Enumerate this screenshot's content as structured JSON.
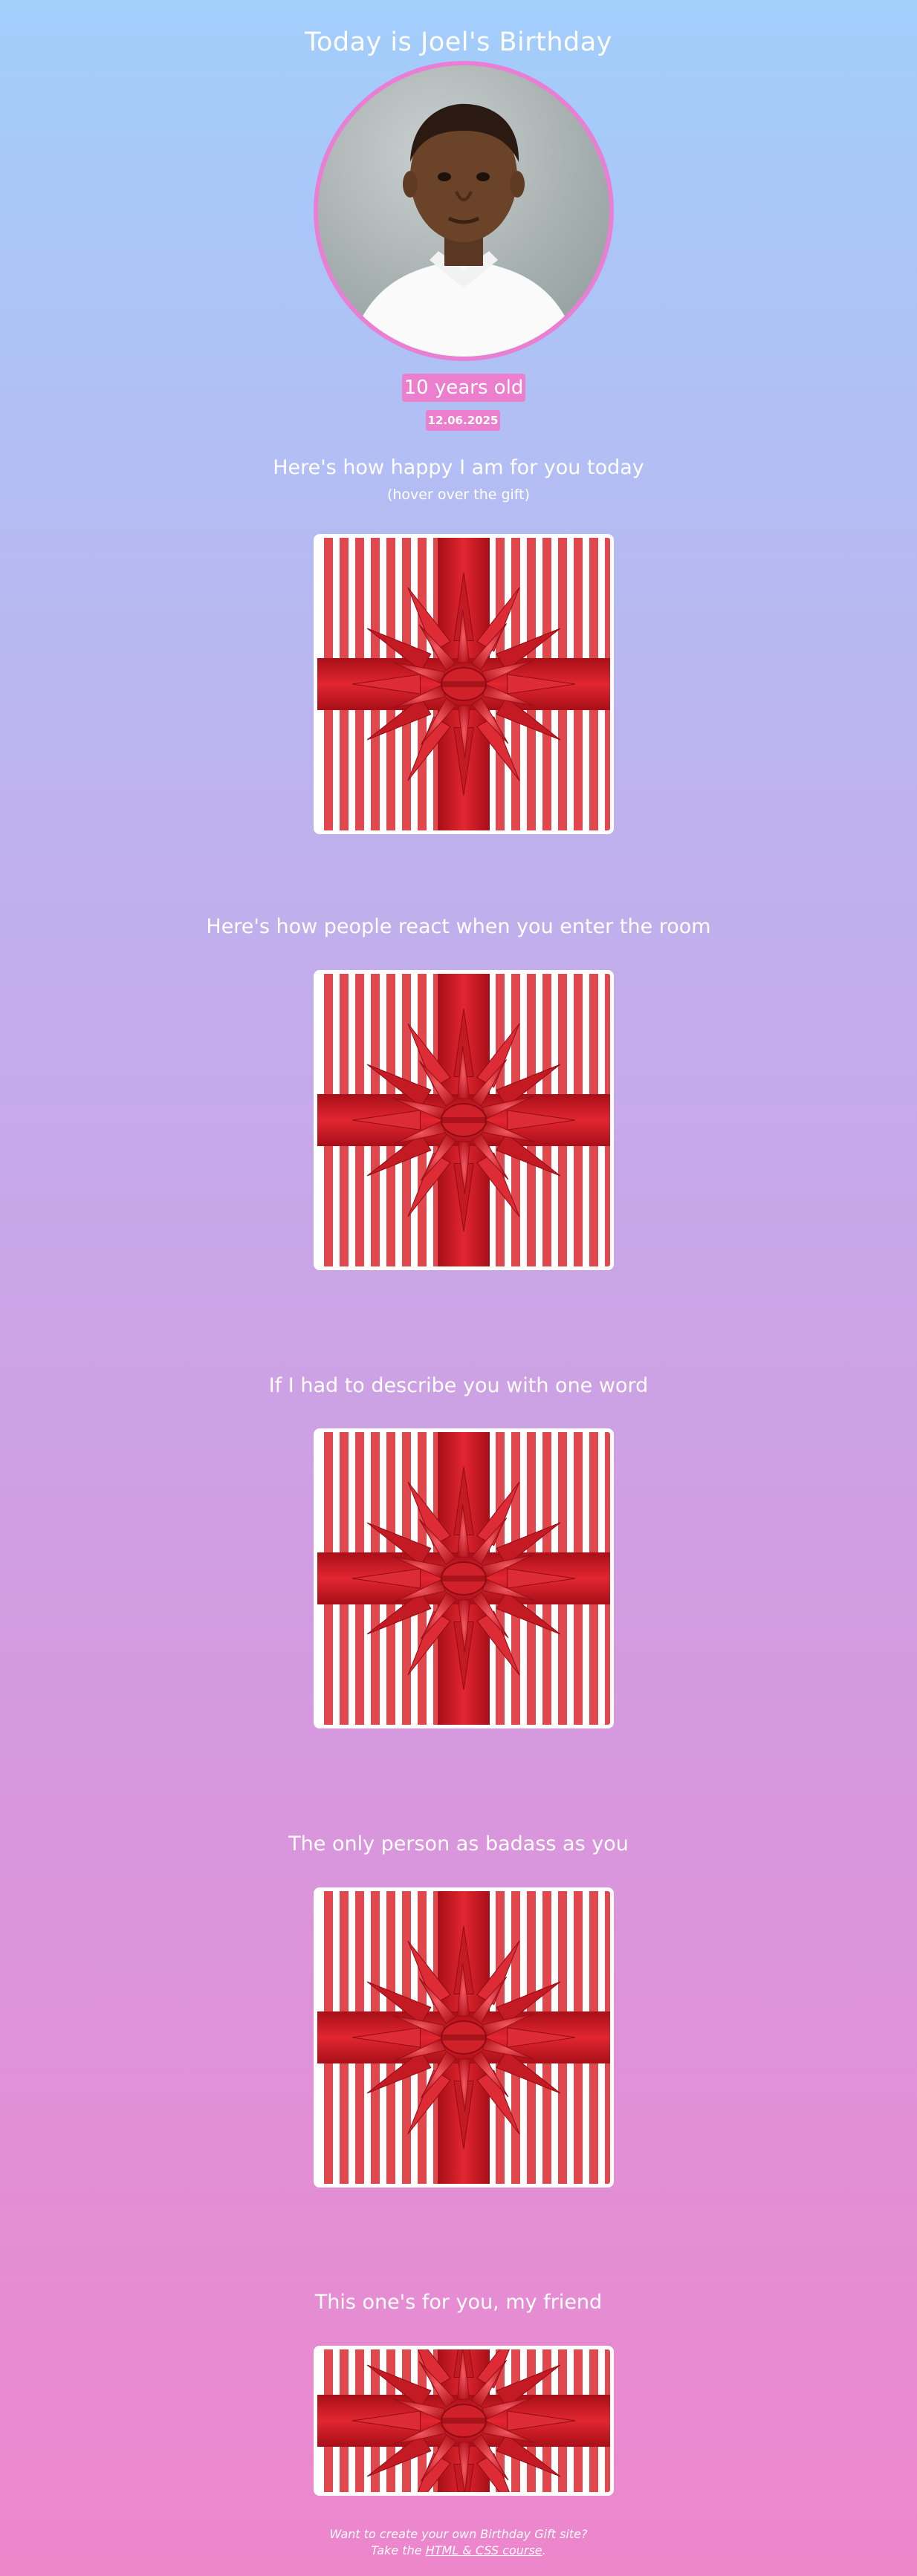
{
  "header": {
    "title": "Today is Joel's Birthday"
  },
  "profile": {
    "photo_alt": "Photo of Joel"
  },
  "age_badge": "10 years old",
  "date_badge": "12.06.2025",
  "sections": [
    {
      "caption": "Here's how happy I am for you today",
      "hint": "(hover over the gift)"
    },
    {
      "caption": "Here's how people react when you enter the room"
    },
    {
      "caption": "If I had to describe you with one word"
    },
    {
      "caption": "The only person as badass as you"
    },
    {
      "caption": "This one's for you, my friend"
    }
  ],
  "footer": {
    "line1": "Want to create your own Birthday Gift site?",
    "line2_prefix": "Take the ",
    "link_text": "HTML & CSS course",
    "line2_suffix": "."
  },
  "colors": {
    "badge": "#eb7fce",
    "photo_border": "#e97fd2",
    "ribbon": "#c8151e",
    "stripe": "#e0484d"
  },
  "icons": [
    "gift-bow-icon"
  ]
}
